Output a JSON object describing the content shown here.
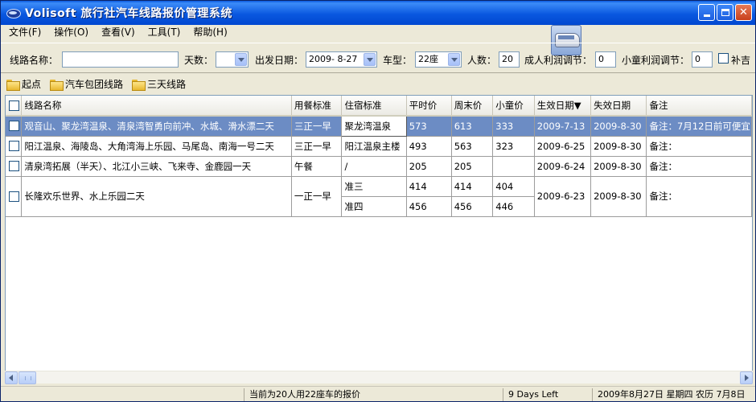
{
  "window": {
    "title": "Volisoft 旅行社汽车线路报价管理系统"
  },
  "menu": [
    "文件(F)",
    "操作(O)",
    "查看(V)",
    "工具(T)",
    "帮助(H)"
  ],
  "search": {
    "route_label": "线路名称：",
    "route_value": "",
    "days_label": "天数：",
    "days_value": "",
    "date_label": "出发日期：",
    "date_value": "2009- 8-27",
    "type_label": "车型：",
    "type_value": "22座",
    "people_label": "人数：",
    "people_value": "20",
    "adult_label": "成人利润调节：",
    "adult_value": "0",
    "child_label": "小童利润调节：",
    "child_value": "0",
    "supp_label": "补吉"
  },
  "categories": [
    "起点",
    "汽车包团线路",
    "三天线路"
  ],
  "grid": {
    "headers": [
      "线路名称",
      "用餐标准",
      "住宿标准",
      "平时价",
      "周末价",
      "小童价",
      "生效日期▼",
      "失效日期",
      "备注"
    ],
    "rows": [
      {
        "name": "观音山、聚龙湾温泉、清泉湾智勇向前冲、水城、滑水漂二天",
        "meal": "三正一早",
        "hotel": "聚龙湾温泉",
        "weekday": "573",
        "weekend": "613",
        "child": "333",
        "start": "2009-7-13",
        "end": "2009-8-30",
        "note": "备注：7月12日前可便宜"
      },
      {
        "name": "阳江温泉、海陵岛、大角湾海上乐园、马尾岛、南海一号二天",
        "meal": "三正一早",
        "hotel": "阳江温泉主楼",
        "weekday": "493",
        "weekend": "563",
        "child": "323",
        "start": "2009-6-25",
        "end": "2009-8-30",
        "note": "备注："
      },
      {
        "name": "清泉湾拓展（半天）、北江小三峡、飞来寺、金鹿园一天",
        "meal": "午餐",
        "hotel": "/",
        "weekday": "205",
        "weekend": "205",
        "child": "",
        "start": "2009-6-24",
        "end": "2009-8-30",
        "note": "备注："
      },
      {
        "name": "长隆欢乐世界、水上乐园二天",
        "meal": "一正一早",
        "start": "2009-6-23",
        "end": "2009-8-30",
        "note": "备注：",
        "sub": [
          {
            "hotel": "准三",
            "weekday": "414",
            "weekend": "414",
            "child": "404"
          },
          {
            "hotel": "准四",
            "weekday": "456",
            "weekend": "456",
            "child": "446"
          }
        ]
      }
    ]
  },
  "status": {
    "message": "当前为20人用22座车的报价",
    "days_left": "9 Days Left",
    "date": "2009年8月27日 星期四 农历 7月8日"
  }
}
